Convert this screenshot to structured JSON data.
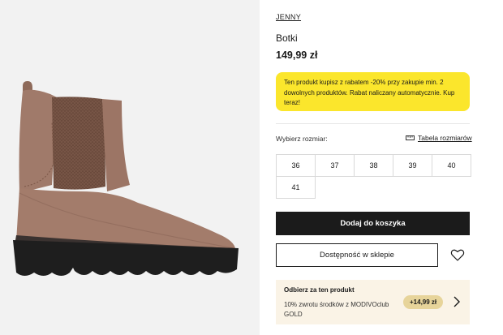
{
  "product": {
    "brand": "JENNY",
    "name": "Botki",
    "price": "149,99 zł",
    "promo_text": "Ten produkt kupisz z rabatem -20% przy zakupie min. 2 dowolnych produktów. Rabat naliczany automatycznie. Kup teraz!",
    "image_icon": "boot-image"
  },
  "size_selector": {
    "label": "Wybierz rozmiar:",
    "size_table_link": "Tabela rozmiarów",
    "size_table_icon": "ruler-icon",
    "sizes": [
      "36",
      "37",
      "38",
      "39",
      "40",
      "41"
    ]
  },
  "actions": {
    "add_to_cart": "Dodaj do koszyka",
    "store_availability": "Dostępność w sklepie",
    "wishlist_icon": "heart-icon"
  },
  "club": {
    "title": "Odbierz za ten produkt",
    "description": "10% zwrotu środków z MODIVOclub GOLD",
    "reward": "+14,99 zł",
    "arrow_icon": "chevron-right-icon"
  },
  "colors": {
    "promo_background": "#fbe62c",
    "button_dark": "#1b1b1b",
    "club_background": "#faf3e6",
    "club_badge": "#e7d49a",
    "boot_suede": "#9c7565",
    "boot_sole": "#1e1e1e"
  }
}
